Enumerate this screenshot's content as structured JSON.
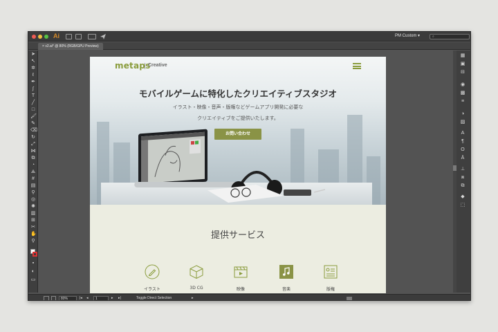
{
  "window": {
    "app_logo": "Ai",
    "workspace": "PM Custom",
    "workspace_arrow": "▾",
    "search_placeholder": ""
  },
  "tabs": [
    {
      "label": "v2.ai* @ 80% (RGB/GPU Preview)",
      "close": "×"
    }
  ],
  "statusbar": {
    "zoom": "80%",
    "page": "1",
    "status_text": "Toggle Direct Selection"
  },
  "site": {
    "logo": "metaps",
    "logo_sub": "Creative",
    "hero_title": "モバイルゲームに特化したクリエイティブスタジオ",
    "hero_sub_1": "イラスト・映像・音声・版権などゲームアプリ開発に必要な",
    "hero_sub_2": "クリエイティブをご提供いたします。",
    "cta": "お問い合わせ",
    "services_title": "提供サービス",
    "services": [
      {
        "label": "イラスト",
        "icon": "pencil-icon"
      },
      {
        "label": "3D CG",
        "icon": "cube-icon"
      },
      {
        "label": "映像",
        "icon": "video-icon"
      },
      {
        "label": "音楽",
        "icon": "music-icon"
      },
      {
        "label": "版権",
        "icon": "license-icon"
      }
    ]
  },
  "colors": {
    "accent": "#8a9c3c",
    "cta_bg": "#8a9346",
    "services_bg": "#ecede1",
    "ui_dark": "#535353"
  }
}
